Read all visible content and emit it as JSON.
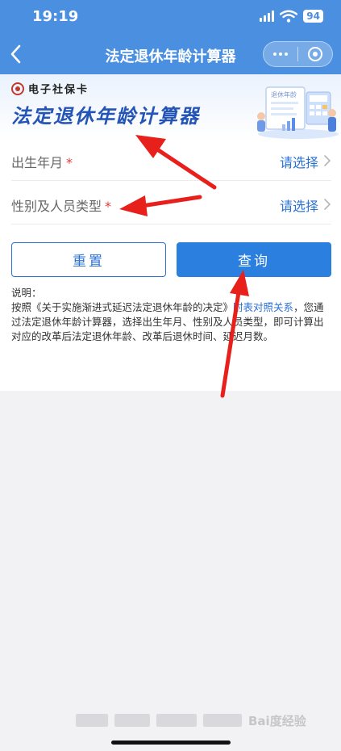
{
  "status": {
    "time": "19:19",
    "battery": "94"
  },
  "nav": {
    "title": "法定退休年龄计算器"
  },
  "banner": {
    "brand": "电子社保卡",
    "title": "法定退休年龄计算器",
    "illustration_tag": "退休年龄"
  },
  "form": {
    "birth": {
      "label": "出生年月",
      "required_mark": "*",
      "value": "请选择"
    },
    "gender": {
      "label": "性别及人员类型",
      "required_mark": "*",
      "value": "请选择"
    }
  },
  "buttons": {
    "reset": "重置",
    "query": "查询"
  },
  "notes": {
    "heading": "说明：",
    "p1": "按照",
    "decision": "《关于实施渐进式延迟法定退休年龄的决定》",
    "link": "附表对照关系",
    "p2": "，您通过法定退休年龄计算器，选择出生年月、性别及人员类型，即可计算出对应的改革后法定退休年龄、改革后退休时间、延迟月数。"
  },
  "watermark": {
    "text": "Bai度经验"
  },
  "colors": {
    "header": "#4a8fe0",
    "accent": "#2a72d4",
    "button": "#2a7fdf",
    "required": "#e23b3b",
    "arrow": "#e8201c"
  }
}
